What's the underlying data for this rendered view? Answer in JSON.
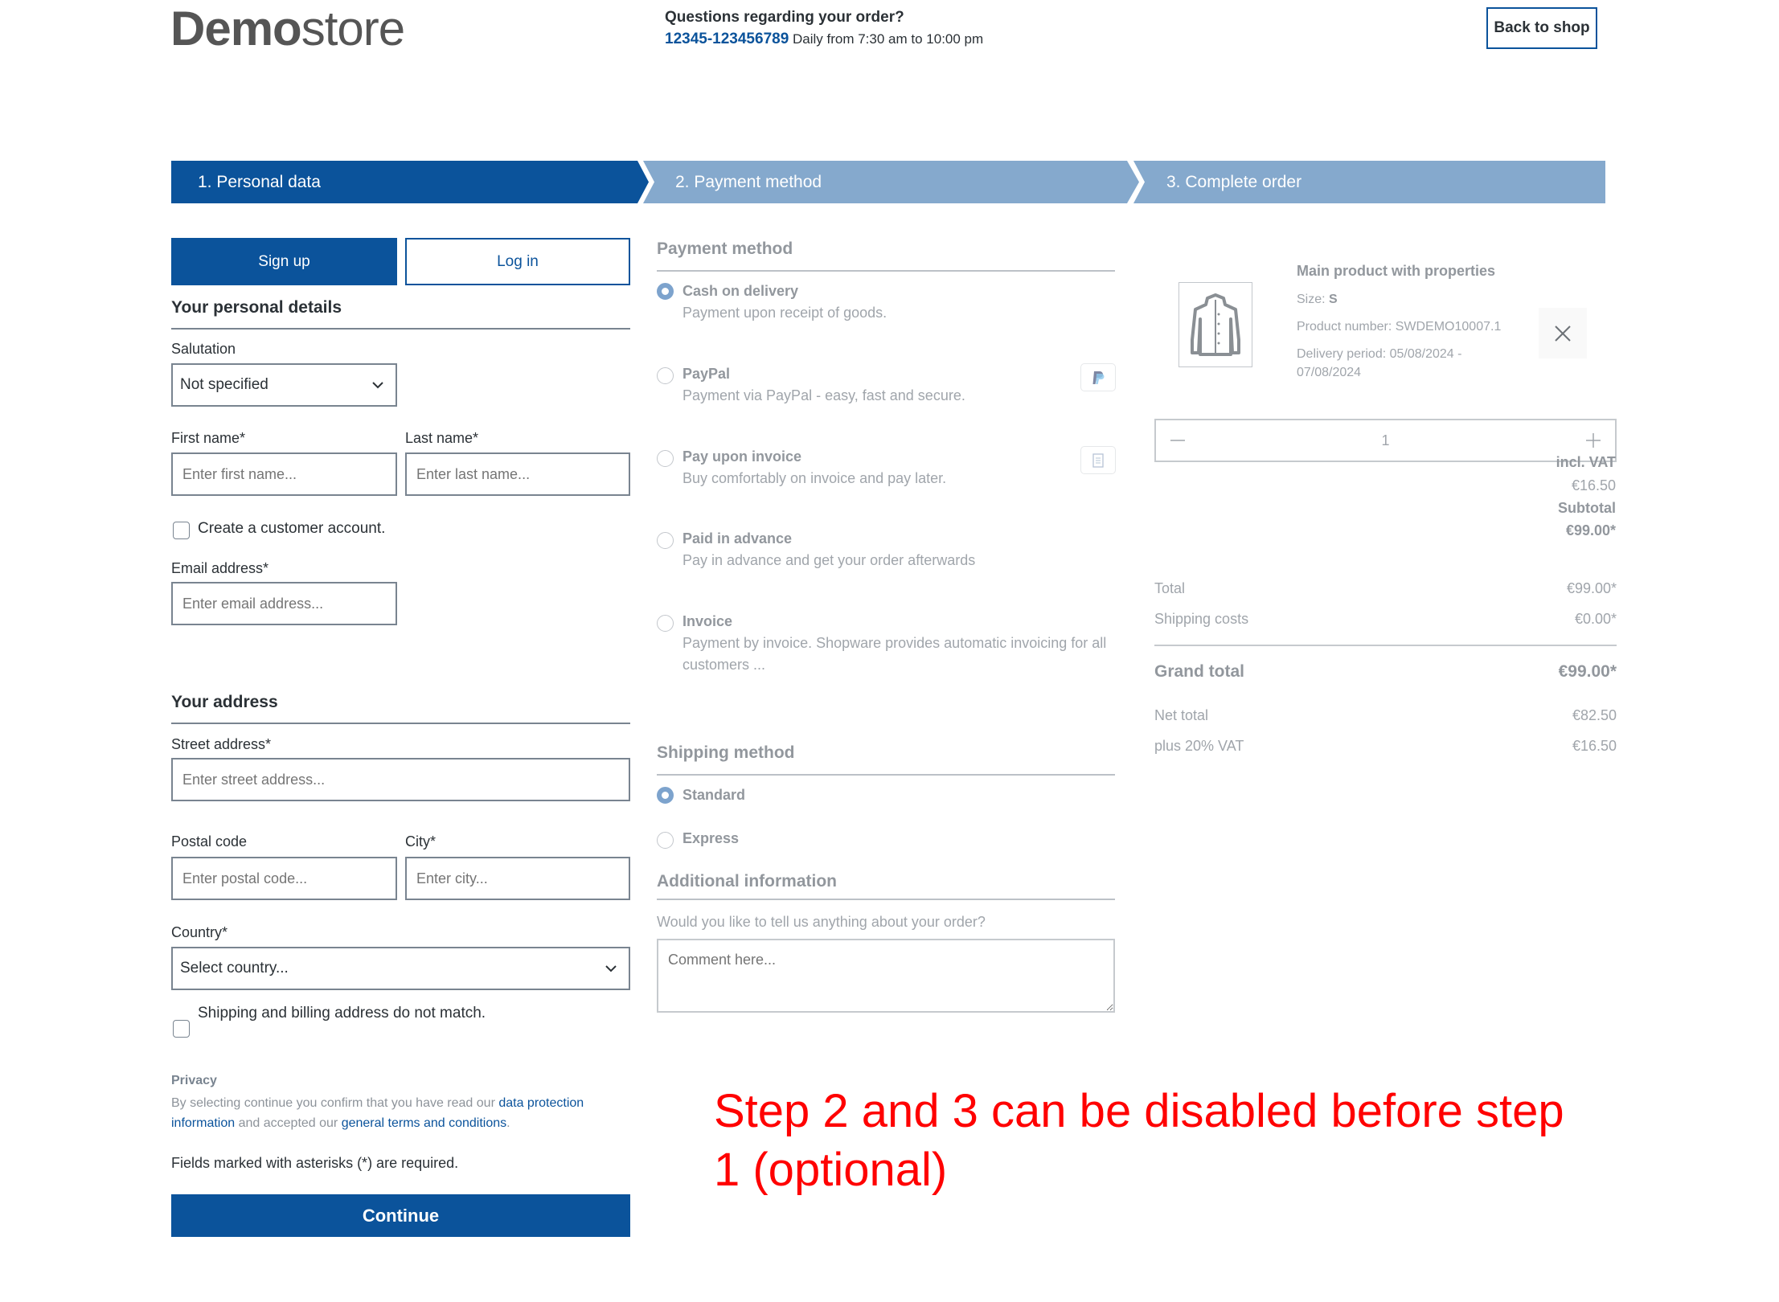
{
  "header": {
    "logo_bold": "Demo",
    "logo_light": "store",
    "help_title": "Questions regarding your order?",
    "phone": "12345-123456789",
    "hours": "Daily from 7:30 am to 10:00 pm",
    "back_to_shop": "Back to shop"
  },
  "steps": [
    {
      "label": "1. Personal data",
      "state": "active",
      "color": "#0b539b"
    },
    {
      "label": "2. Payment method",
      "state": "inactive",
      "color": "#85a9cd"
    },
    {
      "label": "3. Complete order",
      "state": "inactive",
      "color": "#85a9cd"
    }
  ],
  "personal": {
    "signup_label": "Sign up",
    "login_label": "Log in",
    "details_heading": "Your personal details",
    "salutation_label": "Salutation",
    "salutation_value": "Not specified",
    "first_name_label": "First name*",
    "first_name_placeholder": "Enter first name...",
    "last_name_label": "Last name*",
    "last_name_placeholder": "Enter last name...",
    "create_account_label": "Create a customer account.",
    "create_account_checked": false,
    "email_label": "Email address*",
    "email_placeholder": "Enter email address..."
  },
  "address": {
    "heading": "Your address",
    "street_label": "Street address*",
    "street_placeholder": "Enter street address...",
    "postal_label": "Postal code",
    "postal_placeholder": "Enter postal code...",
    "city_label": "City*",
    "city_placeholder": "Enter city...",
    "country_label": "Country*",
    "country_value": "Select country...",
    "different_shipping_label": "Shipping and billing address do not match.",
    "different_shipping_checked": false
  },
  "privacy": {
    "heading": "Privacy",
    "text_before": "By selecting continue you confirm that you have read our ",
    "link1": "data protection information",
    "text_middle": " and accepted our ",
    "link2": "general terms and conditions",
    "text_after": ".",
    "required_note": "Fields marked with asterisks (*) are required.",
    "continue_label": "Continue"
  },
  "payment": {
    "heading": "Payment method",
    "methods": [
      {
        "title": "Cash on delivery",
        "description": "Payment upon receipt of goods.",
        "selected": true,
        "icon": ""
      },
      {
        "title": "PayPal",
        "description": "Payment via PayPal - easy, fast and secure.",
        "selected": false,
        "icon": "paypal-icon"
      },
      {
        "title": "Pay upon invoice",
        "description": "Buy comfortably on invoice and pay later.",
        "selected": false,
        "icon": "invoice-icon"
      },
      {
        "title": "Paid in advance",
        "description": "Pay in advance and get your order afterwards",
        "selected": false,
        "icon": ""
      },
      {
        "title": "Invoice",
        "description": "Payment by invoice. Shopware provides automatic invoicing for all customers ...",
        "selected": false,
        "icon": ""
      }
    ]
  },
  "shipping": {
    "heading": "Shipping method",
    "methods": [
      {
        "title": "Standard",
        "selected": true
      },
      {
        "title": "Express",
        "selected": false
      }
    ]
  },
  "additional": {
    "heading": "Additional information",
    "question": "Would you like to tell us anything about your order?",
    "comment_placeholder": "Comment here..."
  },
  "cart": {
    "product_name": "Main product with properties",
    "size_label": "Size:",
    "size_value": "S",
    "product_number": "Product number: SWDEMO10007.1",
    "delivery_line1": "Delivery period: 05/08/2024 -",
    "delivery_line2": "07/08/2024",
    "quantity": "1",
    "incl_vat_label": "incl. VAT",
    "incl_vat_value": "€16.50",
    "subtotal_label": "Subtotal",
    "subtotal_value": "€99.00*"
  },
  "summary": {
    "total_label": "Total",
    "total_value": "€99.00*",
    "shipping_label": "Shipping costs",
    "shipping_value": "€0.00*",
    "grand_label": "Grand total",
    "grand_value": "€99.00*",
    "net_label": "Net total",
    "net_value": "€82.50",
    "vat_label": "plus 20% VAT",
    "vat_value": "€16.50"
  },
  "annotation": {
    "text": "Step 2 and 3 can be disabled before step 1 (optional)",
    "color": "#ff0000"
  }
}
